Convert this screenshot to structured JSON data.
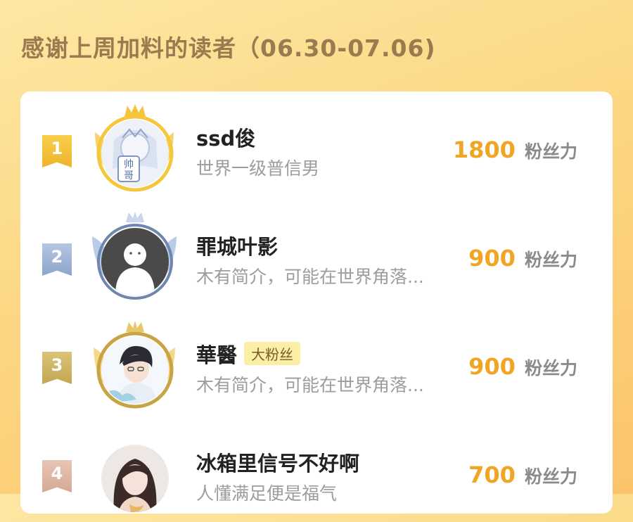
{
  "header": {
    "title": "感谢上周加料的读者（06.30-07.06)"
  },
  "colors": {
    "accent": "#f0a524",
    "gold": "#eeb42c",
    "silver": "#8ea4cb",
    "bronze": "#c3a652",
    "rank4": "#d6a894"
  },
  "readers": [
    {
      "rank": "1",
      "name": "ssd俊",
      "bio": "世界一级普信男",
      "score": "1800",
      "unit": "粉丝力",
      "avatar": "avatar-anime-icon"
    },
    {
      "rank": "2",
      "name": "罪城叶影",
      "bio": "木有简介，可能在世界角落...",
      "score": "900",
      "unit": "粉丝力",
      "avatar": "default-avatar-icon"
    },
    {
      "rank": "3",
      "name": "華醫",
      "badge": "大粉丝",
      "bio": "木有简介，可能在世界角落...",
      "score": "900",
      "unit": "粉丝力",
      "avatar": "avatar-boy-icon"
    },
    {
      "rank": "4",
      "name": "冰箱里信号不好啊",
      "bio": "人懂满足便是福气",
      "score": "700",
      "unit": "粉丝力",
      "avatar": "avatar-girl-icon"
    }
  ]
}
